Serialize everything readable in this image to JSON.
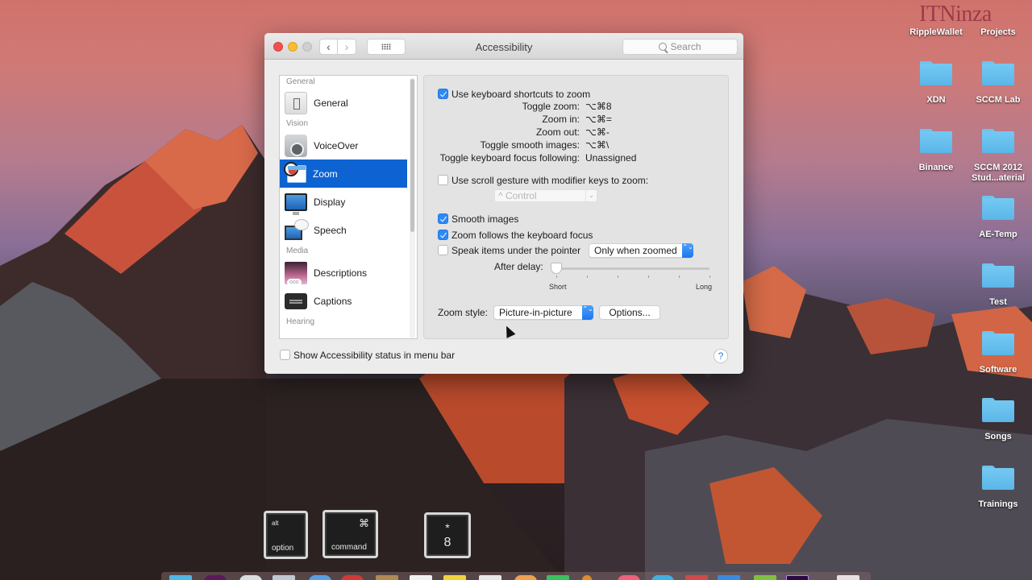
{
  "desktop": {
    "watermark": "ITNinza",
    "icons": [
      {
        "label": "RippleWallet"
      },
      {
        "label": "Projects"
      },
      {
        "label": "XDN"
      },
      {
        "label": "SCCM Lab"
      },
      {
        "label": "Binance"
      },
      {
        "label": "SCCM 2012 Stud...aterial"
      },
      {
        "label": "AE-Temp"
      },
      {
        "label": "Test"
      },
      {
        "label": "Software"
      },
      {
        "label": "Songs"
      },
      {
        "label": "Trainings"
      }
    ]
  },
  "window": {
    "title": "Accessibility",
    "search_placeholder": "Search",
    "nav": {
      "back": "‹",
      "forward": "›"
    },
    "sidebar": {
      "sections": [
        {
          "header": "General",
          "items": [
            {
              "label": "General",
              "icon": "general-icon"
            }
          ]
        },
        {
          "header": "Vision",
          "items": [
            {
              "label": "VoiceOver",
              "icon": "voiceover-icon"
            },
            {
              "label": "Zoom",
              "icon": "zoom-icon",
              "selected": true
            },
            {
              "label": "Display",
              "icon": "display-icon"
            },
            {
              "label": "Speech",
              "icon": "speech-icon"
            }
          ]
        },
        {
          "header": "Media",
          "items": [
            {
              "label": "Descriptions",
              "icon": "descriptions-icon"
            },
            {
              "label": "Captions",
              "icon": "captions-icon"
            }
          ]
        },
        {
          "header": "Hearing",
          "items": []
        }
      ]
    },
    "zoom_pane": {
      "use_keyboard_shortcuts": {
        "label": "Use keyboard shortcuts to zoom",
        "checked": true
      },
      "shortcuts": [
        {
          "name": "Toggle zoom:",
          "keys": "⌥⌘8"
        },
        {
          "name": "Zoom in:",
          "keys": "⌥⌘="
        },
        {
          "name": "Zoom out:",
          "keys": "⌥⌘-"
        },
        {
          "name": "Toggle smooth images:",
          "keys": "⌥⌘\\"
        },
        {
          "name": "Toggle keyboard focus following:",
          "keys": "Unassigned"
        }
      ],
      "scroll_gesture": {
        "label": "Use scroll gesture with modifier keys to zoom:",
        "checked": false
      },
      "modifier_select": {
        "value": "^ Control",
        "arrow": "⌄"
      },
      "smooth_images": {
        "label": "Smooth images",
        "checked": true
      },
      "follow_focus": {
        "label": "Zoom follows the keyboard focus",
        "checked": true
      },
      "speak_items": {
        "label": "Speak items under the pointer",
        "checked": false
      },
      "speak_mode": {
        "value": "Only when zoomed"
      },
      "delay": {
        "label": "After delay:",
        "min_label": "Short",
        "max_label": "Long",
        "value_fraction": 0.0,
        "ticks": 6
      },
      "zoom_style": {
        "label": "Zoom style:",
        "value": "Picture-in-picture"
      },
      "options_button": "Options..."
    },
    "show_status_menu": {
      "label": "Show Accessibility status in menu bar",
      "checked": false
    },
    "help": "?"
  },
  "keystroke_overlay": [
    {
      "top": "alt",
      "bottom": "option"
    },
    {
      "top": "⌘",
      "bottom": "command"
    },
    {
      "top": "*",
      "bottom": "8"
    }
  ],
  "stepper_glyph": "⌃⌄"
}
